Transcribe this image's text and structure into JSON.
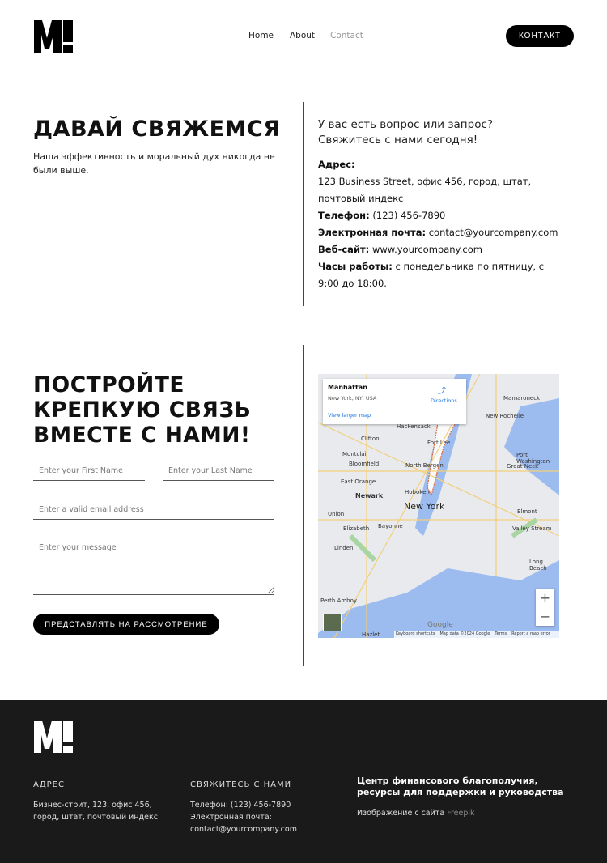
{
  "header": {
    "nav": [
      "Home",
      "About",
      "Contact"
    ],
    "cta": "КОНТАКТ"
  },
  "intro": {
    "title": "ДАВАЙ СВЯЖЕМСЯ",
    "subtitle": "Наша эффективность и моральный дух никогда не были выше.",
    "question": "У вас есть вопрос или запрос?",
    "call": "Свяжитесь с нами сегодня!",
    "address_label": "Адрес:",
    "address": "123 Business Street, офис 456, город, штат, почтовый индекс",
    "phone_label": "Телефон:",
    "phone": "(123) 456-7890",
    "email_label": "Электронная почта:",
    "email": "contact@yourcompany.com",
    "site_label": "Веб-сайт:",
    "site": "www.yourcompany.com",
    "hours_label": "Часы работы:",
    "hours": "с понедельника по пятницу, с 9:00 до 18:00."
  },
  "form": {
    "title": "ПОСТРОЙТЕ КРЕПКУЮ СВЯЗЬ ВМЕСТЕ С НАМИ!",
    "first_name_placeholder": "Enter your First Name",
    "last_name_placeholder": "Enter your Last Name",
    "email_placeholder": "Enter a valid email address",
    "message_placeholder": "Enter your message",
    "submit": "ПРЕДСТАВЛЯТЬ НА РАССМОТРЕНИЕ"
  },
  "map": {
    "place": "Manhattan",
    "place_sub": "New York, NY, USA",
    "directions": "Directions",
    "larger": "View larger map",
    "city": "New York",
    "labels": [
      "Hackensack",
      "Clifton",
      "Fort Lee",
      "Montclair",
      "Bloomfield",
      "North Bergen",
      "East Orange",
      "Newark",
      "Hoboken",
      "Union",
      "Elizabeth",
      "Bayonne",
      "Linden",
      "Perth Amboy",
      "New Rochelle",
      "Mamaroneck",
      "Port Washington",
      "Great Neck",
      "Elmont",
      "Valley Stream",
      "Long Beach",
      "Hazlet"
    ],
    "footer": [
      "Keyboard shortcuts",
      "Map data ©2024 Google",
      "Terms",
      "Report a map error"
    ],
    "google": "Google",
    "zoom_in": "+",
    "zoom_out": "−"
  },
  "footer": {
    "address_title": "АДРЕС",
    "address": "Бизнес-стрит, 123, офис 456, город, штат, почтовый индекс",
    "contact_title": "СВЯЖИТЕСЬ С НАМИ",
    "phone": "Телефон: (123) 456-7890",
    "email_label": "Электронная почта:",
    "email": "contact@yourcompany.com",
    "tagline": "Центр финансового благополучия, ресурсы для поддержки и руководства",
    "credit": "Изображение с сайта",
    "credit_link": "Freepik"
  }
}
